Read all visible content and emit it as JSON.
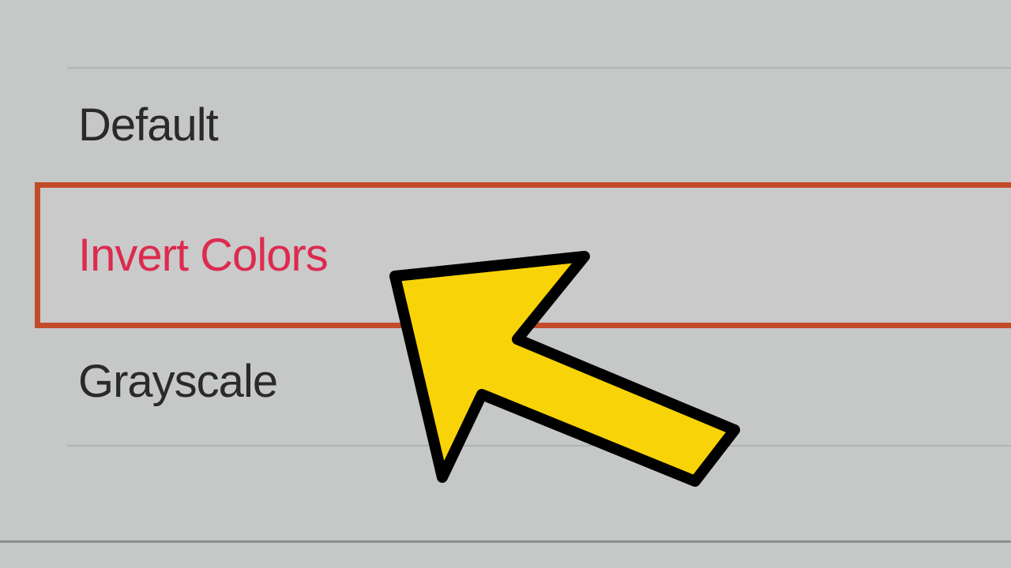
{
  "options": {
    "default": "Default",
    "invert": "Invert Colors",
    "grayscale": "Grayscale"
  }
}
